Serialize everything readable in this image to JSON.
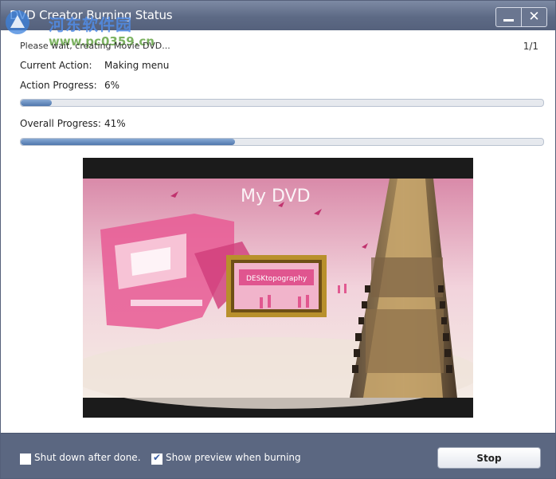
{
  "window": {
    "title": "DVD Creator Burning Status",
    "close_glyph": "✕"
  },
  "watermark": {
    "text": "河东软件园",
    "url": "www.pc0359.cn"
  },
  "status": {
    "message": "Please wait, creating Movie DVD...",
    "page": "1/1"
  },
  "current_action": {
    "label": "Current Action:",
    "value": "Making menu"
  },
  "action_progress": {
    "label": "Action Progress:",
    "text": "6%",
    "value": 0.06
  },
  "overall_progress": {
    "label": "Overall Progress:",
    "text": "41%",
    "value": 0.41
  },
  "preview": {
    "menu_title": "My DVD",
    "frame_text": "DESKtopography"
  },
  "footer": {
    "shutdown_label": "Shut down after done.",
    "shutdown_checked": false,
    "preview_label": "Show preview when burning",
    "preview_checked": true,
    "stop_label": "Stop"
  },
  "colors": {
    "titlebar": "#5d6a85",
    "progress_fill": "#4f77ad",
    "footer": "#5b6781",
    "preview_pink": "#e85a94"
  },
  "icons": [
    "minimize-icon",
    "close-icon",
    "checkbox-icon",
    "checkmark-icon"
  ]
}
